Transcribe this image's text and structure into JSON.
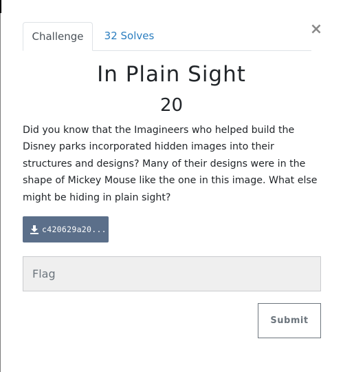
{
  "modal": {
    "close_label": "×",
    "tabs": [
      {
        "label": "Challenge",
        "active": true
      },
      {
        "label": "32 Solves",
        "active": false
      }
    ],
    "challenge": {
      "name": "In Plain Sight",
      "value": "20",
      "description": "Did you know that the Imagineers who helped build the Disney parks incorporated hidden images into their structures and designs? Many of their designs were in the shape of Mickey Mouse like the one in this image. What else might be hiding in plain sight?",
      "file_label": "c420629a20..."
    },
    "flag": {
      "placeholder": "Flag",
      "value": ""
    },
    "submit_label": "Submit"
  },
  "icons": {
    "close": "close-icon",
    "download": "download-icon"
  },
  "colors": {
    "tab_link": "#2a7dbf",
    "download_button": "#5b6f8a",
    "input_background": "#efefef",
    "submit_border": "#6c757d"
  }
}
